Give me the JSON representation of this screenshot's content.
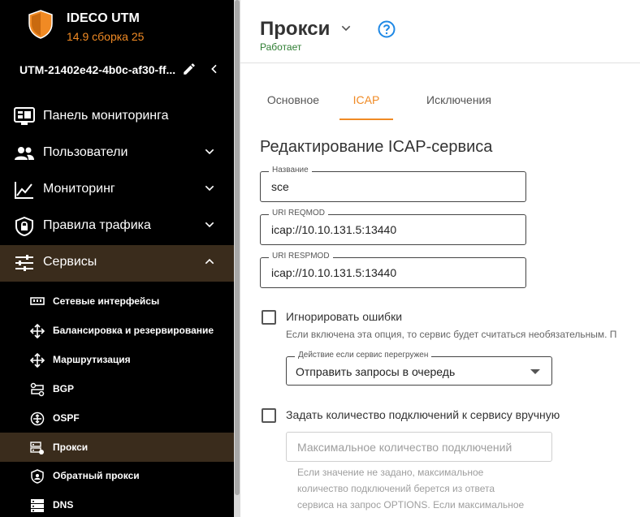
{
  "brand": {
    "name": "IDECO UTM",
    "version": "14.9 сборка 25",
    "accent": "#f08a24"
  },
  "device": {
    "name": "UTM-21402e42-4b0c-af30-ff..."
  },
  "nav": [
    {
      "label": "Панель мониторинга",
      "icon": "dashboard-icon",
      "chevron": ""
    },
    {
      "label": "Пользователи",
      "icon": "users-icon",
      "chevron": "down"
    },
    {
      "label": "Мониторинг",
      "icon": "chart-line-icon",
      "chevron": "down"
    },
    {
      "label": "Правила трафика",
      "icon": "lock-shield-icon",
      "chevron": "down"
    },
    {
      "label": "Сервисы",
      "icon": "sliders-icon",
      "chevron": "up",
      "active": true
    }
  ],
  "subnav": [
    {
      "label": "Сетевые интерфейсы",
      "icon": "network-interface-icon"
    },
    {
      "label": "Балансировка и резервирование",
      "icon": "move-arrows-icon"
    },
    {
      "label": "Маршрутизация",
      "icon": "routing-arrows-icon"
    },
    {
      "label": "BGP",
      "icon": "bgp-icon"
    },
    {
      "label": "OSPF",
      "icon": "ospf-icon"
    },
    {
      "label": "Прокси",
      "icon": "proxy-server-icon",
      "active": true
    },
    {
      "label": "Обратный прокси",
      "icon": "reverse-proxy-shield-icon"
    },
    {
      "label": "DNS",
      "icon": "dns-server-icon"
    }
  ],
  "page": {
    "title": "Прокси",
    "status": "Работает",
    "status_color": "#2e7d32"
  },
  "tabs": [
    {
      "label": "Основное"
    },
    {
      "label": "ICAP",
      "active": true
    },
    {
      "label": "Исключения"
    }
  ],
  "form": {
    "section_title": "Редактирование ICAP-сервиса",
    "name_label": "Название",
    "name_value": "sce",
    "reqmod_label": "URI REQMOD",
    "reqmod_value": "icap://10.10.131.5:13440",
    "respmod_label": "URI RESPMOD",
    "respmod_value": "icap://10.10.131.5:13440",
    "ignore_errors_label": "Игнорировать ошибки",
    "ignore_errors_hint": "Если включена эта опция, то сервис будет считаться необязательным. П",
    "overload_label": "Действие если сервис перегружен",
    "overload_value": "Отправить запросы в очередь",
    "manual_connections_label": "Задать количество подключений к сервису вручную",
    "max_connections_placeholder": "Максимальное количество подключений",
    "note_line1": "Если значение не задано, максимальное",
    "note_line2": "количество подключений берется из ответа",
    "note_line3": "сервиса на запрос OPTIONS. Если максимальное"
  }
}
